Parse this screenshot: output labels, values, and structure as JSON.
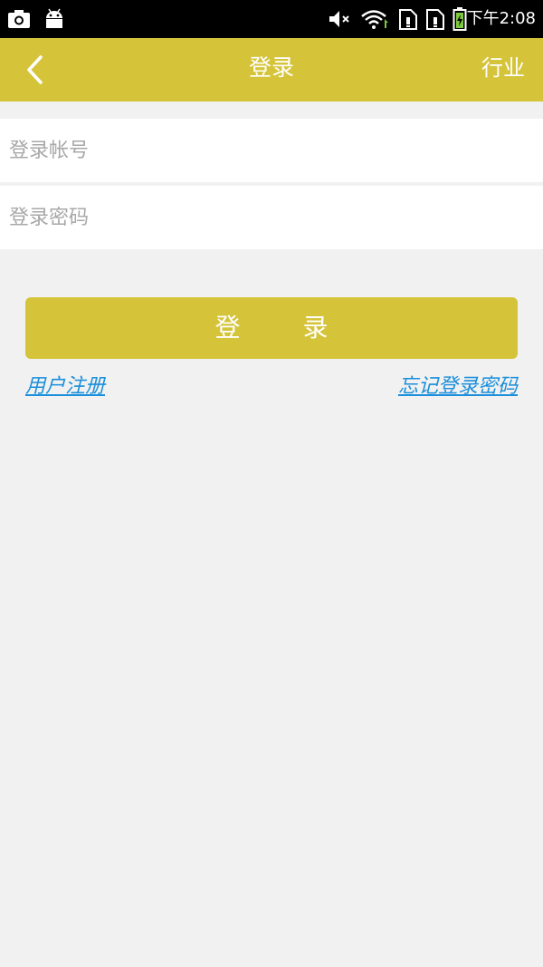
{
  "status_bar": {
    "icons": [
      "screenshot-icon",
      "android-icon",
      "mute-icon",
      "wifi-icon",
      "sim1-icon",
      "sim2-icon",
      "battery-icon"
    ],
    "time": "下午2:08"
  },
  "app_bar": {
    "back_icon": "chevron-left-icon",
    "title": "登录",
    "right_action": "行业"
  },
  "form": {
    "account_placeholder": "登录帐号",
    "account_value": "",
    "password_placeholder": "登录密码",
    "password_value": ""
  },
  "login_button": {
    "label": "登 录"
  },
  "links": {
    "register": "用户注册",
    "forgot_password": "忘记登录密码"
  },
  "colors": {
    "accent": "#d5c43a",
    "link": "#1a8fdb",
    "background": "#f1f1f1",
    "status_bar": "#000000"
  }
}
